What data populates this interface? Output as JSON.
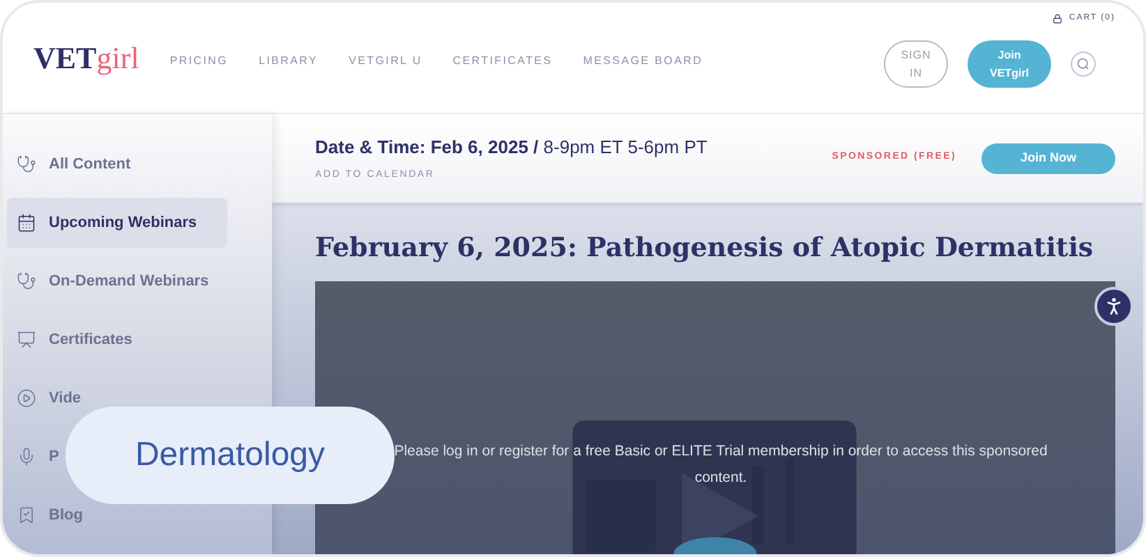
{
  "header": {
    "logo": {
      "strong": "VET",
      "light": "girl"
    },
    "cart": "CART (0)",
    "nav": [
      "PRICING",
      "LIBRARY",
      "VETGIRL U",
      "CERTIFICATES",
      "MESSAGE BOARD"
    ],
    "sign_in": "SIGN IN",
    "join": "Join VETgirl"
  },
  "sidebar": {
    "items": [
      {
        "label": "All Content",
        "selected": false
      },
      {
        "label": "Upcoming Webinars",
        "selected": true
      },
      {
        "label": "On-Demand Webinars",
        "selected": false
      },
      {
        "label": "Certificates",
        "selected": false
      },
      {
        "label": "Vide",
        "selected": false
      },
      {
        "label": "P",
        "selected": false
      },
      {
        "label": "Blog",
        "selected": false
      }
    ]
  },
  "event_bar": {
    "date_time": "**Date & Time: Feb 6, 2025 /** 8-9pm ET 5-6pm PT",
    "add_to_calendar": "ADD TO CALENDAR",
    "sponsored": "SPONSORED (FREE)",
    "join_now": "Join Now"
  },
  "webinar": {
    "title": "February 6, 2025: Pathogenesis of Atopic Dermatitis",
    "video": {
      "kind": "picture",
      "notice": "Please log in or register for a free Basic or ELITE Trial membership in order to access this sponsored content."
    }
  },
  "tag": "Dermatology"
}
